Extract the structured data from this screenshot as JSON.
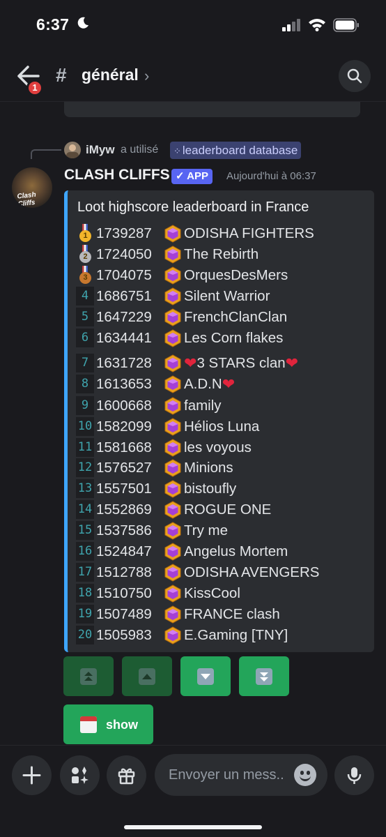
{
  "status": {
    "time": "6:37"
  },
  "header": {
    "back_badge": "1",
    "hash": "#",
    "channel": "général",
    "chevron": "›"
  },
  "reply": {
    "user": "iMyw",
    "used": "a utilisé",
    "command": "leaderboard database"
  },
  "message": {
    "bot_name": "CLASH CLIFFS",
    "app_badge": "✓ APP",
    "avatar_text": "Clash Cliffs",
    "timestamp": "Aujourd'hui à 06:37"
  },
  "embed": {
    "title": "Loot highscore leaderboard in France",
    "rows": [
      {
        "rank": "1",
        "medal": "gold",
        "score": "1739287",
        "clan": "ODISHA FIGHTERS"
      },
      {
        "rank": "2",
        "medal": "silver",
        "score": "1724050",
        "clan": "The Rebirth"
      },
      {
        "rank": "3",
        "medal": "bronze",
        "score": "1704075",
        "clan": "OrquesDesMers"
      },
      {
        "rank": "4",
        "score": "1686751",
        "clan": "Silent Warrior"
      },
      {
        "rank": "5",
        "score": "1647229",
        "clan": "FrenchClanClan"
      },
      {
        "rank": "6",
        "score": "1634441",
        "clan": "Les Corn flakes"
      },
      {
        "rank": "7",
        "score": "1631728",
        "clan": "3 STARS clan",
        "heart_before": true,
        "heart_after": true
      },
      {
        "rank": "8",
        "score": "1613653",
        "clan": "A.D.N",
        "heart_after": true
      },
      {
        "rank": "9",
        "score": "1600668",
        "clan": "family"
      },
      {
        "rank": "10",
        "score": "1582099",
        "clan": "Hélios Luna"
      },
      {
        "rank": "11",
        "score": "1581668",
        "clan": "les voyous"
      },
      {
        "rank": "12",
        "score": "1576527",
        "clan": "Minions"
      },
      {
        "rank": "13",
        "score": "1557501",
        "clan": "bistoufly"
      },
      {
        "rank": "14",
        "score": "1552869",
        "clan": "ROGUE ONE"
      },
      {
        "rank": "15",
        "score": "1537586",
        "clan": "Try me"
      },
      {
        "rank": "16",
        "score": "1524847",
        "clan": "Angelus Mortem"
      },
      {
        "rank": "17",
        "score": "1512788",
        "clan": "ODISHA AVENGERS"
      },
      {
        "rank": "18",
        "score": "1510750",
        "clan": "KissCool"
      },
      {
        "rank": "19",
        "score": "1507489",
        "clan": "FRANCE clash"
      },
      {
        "rank": "20",
        "score": "1505983",
        "clan": "E.Gaming [TNY]"
      }
    ]
  },
  "buttons": {
    "nav": [
      {
        "icon": "double-up-icon",
        "enabled": false
      },
      {
        "icon": "up-icon",
        "enabled": false
      },
      {
        "icon": "down-icon",
        "enabled": true
      },
      {
        "icon": "double-down-icon",
        "enabled": true
      }
    ],
    "show_label": "show"
  },
  "composer": {
    "placeholder": "Envoyer un mess.."
  },
  "colors": {
    "accent": "#5865f2",
    "embed_bar": "#3ea6ff",
    "button_green": "#23a55a",
    "rank_text": "#3fa4ad"
  }
}
